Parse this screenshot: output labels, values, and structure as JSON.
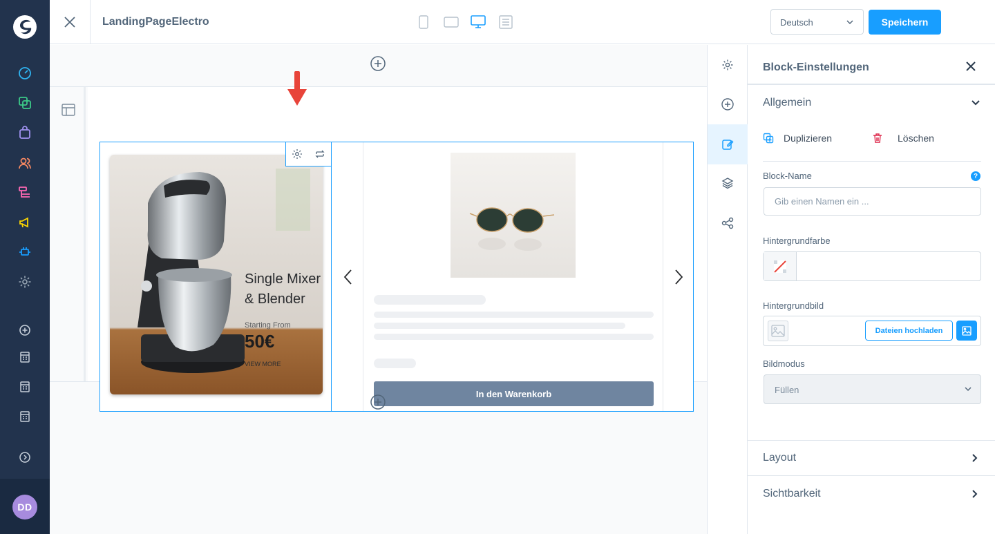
{
  "app": {
    "title": "LandingPageElectro"
  },
  "topbar": {
    "viewports": [
      "mobile-viewport",
      "tablet-viewport",
      "desktop-viewport",
      "full-width-viewport"
    ],
    "active_viewport": "desktop-viewport",
    "language": "Deutsch",
    "save_label": "Speichern"
  },
  "nav": {
    "items": [
      "dashboard-icon",
      "catalogue-icon",
      "orders-icon",
      "customers-icon",
      "content-icon",
      "marketing-icon",
      "extensions-icon",
      "settings-icon"
    ],
    "secondary_items": [
      "add-sales-channel-icon",
      "storefront-icon",
      "storefront-icon",
      "storefront-icon"
    ],
    "avatar_initials": "DD",
    "colors": {
      "dashboard": "#2fb5f3",
      "catalogue": "#3cca88",
      "orders": "#a092f0",
      "customers": "#f88962",
      "content": "#ff68b4",
      "marketing": "#ffd700",
      "extensions": "#189eff",
      "settings": "#9aa8b5"
    }
  },
  "canvas": {
    "banner": {
      "headline_1": "Single Mixer",
      "headline_2": "& Blender",
      "subline": "Starting From",
      "price": "50€",
      "cta": "VIEW MORE"
    },
    "product_card": {
      "cart_label": "In den Warenkorb"
    }
  },
  "panel": {
    "title": "Block-Einstellungen",
    "general_section": "Allgemein",
    "duplicate_label": "Duplizieren",
    "delete_label": "Löschen",
    "block_name_label": "Block-Name",
    "block_name_placeholder": "Gib einen Namen ein ...",
    "help_glyph": "?",
    "bg_color_label": "Hintergrundfarbe",
    "bg_image_label": "Hintergrundbild",
    "upload_label": "Dateien hochladen",
    "image_mode_label": "Bildmodus",
    "image_mode_value": "Füllen",
    "layout_section": "Layout",
    "visibility_section": "Sichtbarkeit"
  },
  "accent_color": "#189eff",
  "annotation_color": "#e8443a"
}
